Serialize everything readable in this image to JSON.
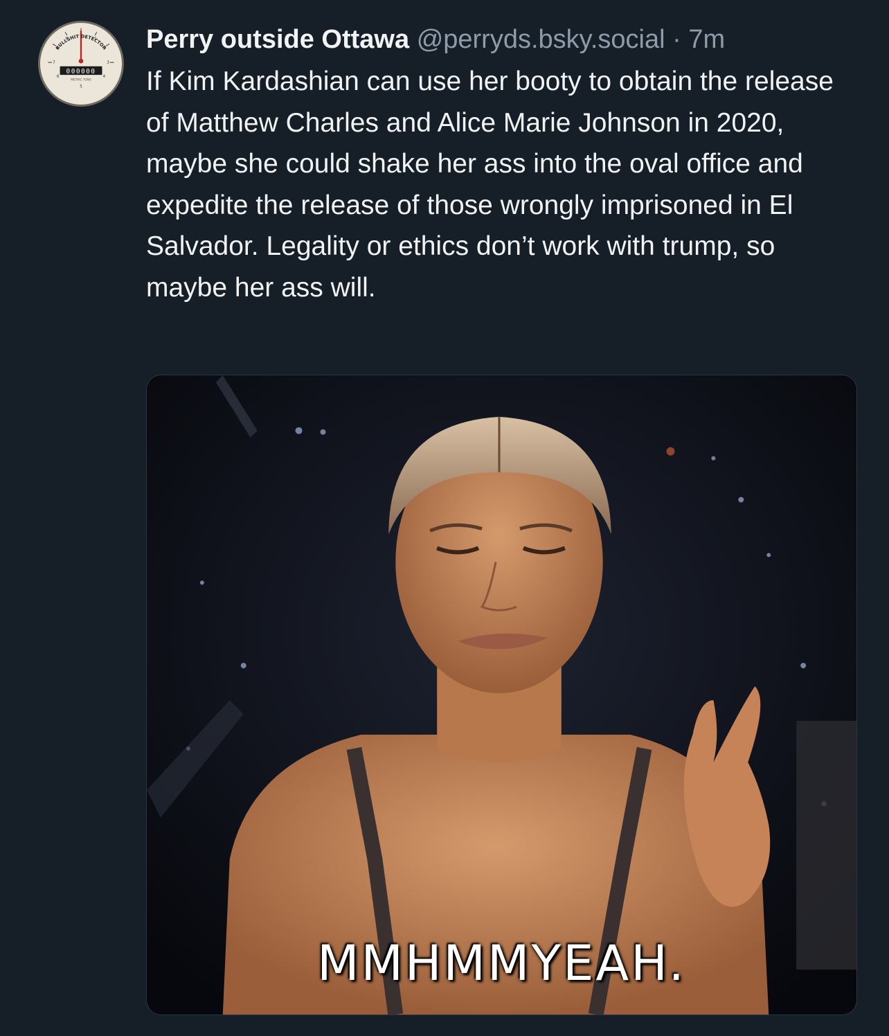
{
  "post": {
    "display_name": "Perry outside Ottawa",
    "handle": "@perryds.bsky.social",
    "separator": "·",
    "timestamp": "7m",
    "text": "If Kim Kardashian can use her booty to obtain the release of Matthew Charles and Alice Marie Johnson in 2020, maybe she could shake her ass into the oval office and expedite the release of those wrongly imprisoned in El Salvador. Legality or ethics don’t work with trump, so maybe her ass will.",
    "avatar": {
      "icon": "bullshit-detector-gauge-icon",
      "label": "BULLSHIT DETECTOR",
      "counter": "000000",
      "unit": "METRIC TONS"
    },
    "media": {
      "type": "gif",
      "caption": "MMHMMYEAH."
    }
  },
  "colors": {
    "background": "#161e27",
    "text_primary": "#f1f3f5",
    "text_secondary": "#8e9bab"
  }
}
